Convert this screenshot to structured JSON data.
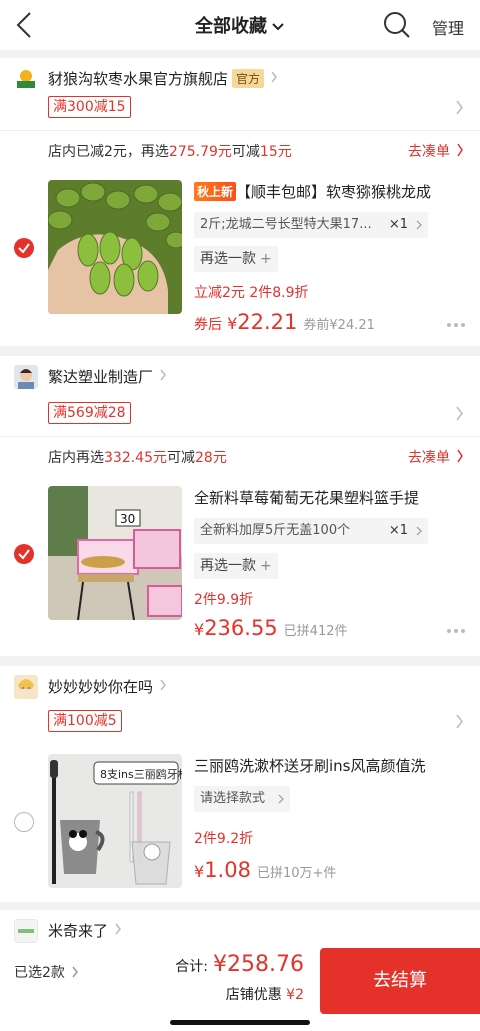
{
  "header": {
    "title": "全部收藏",
    "manage_label": "管理"
  },
  "stores": [
    {
      "name": "豺狼沟软枣水果官方旗舰店",
      "official_tag": "官方",
      "promo": "满300减15",
      "coudan_prefix": "店内已减2元，再选",
      "coudan_amount": "275.79元",
      "coudan_mid": "可减",
      "coudan_save": "15元",
      "coudan_link": "去凑单",
      "checked": true,
      "product": {
        "badge": "秋上新",
        "title": "【顺丰包邮】软枣猕猴桃龙成",
        "sku": "2斤;龙城二号长型特大果17...",
        "qty": "×1",
        "reselect": "再选一款",
        "discount": "立减2元 2件8.9折",
        "price_prefix": "券后",
        "price_symbol": "¥",
        "price": "22.21",
        "price_note": "券前¥24.21"
      }
    },
    {
      "name": "繁达塑业制造厂",
      "promo": "满569减28",
      "coudan_prefix": "店内再选",
      "coudan_amount": "332.45元",
      "coudan_mid": "可减",
      "coudan_save": "28元",
      "coudan_link": "去凑单",
      "checked": true,
      "product": {
        "title": "全新料草莓葡萄无花果塑料篮手提",
        "sku": "全新料加厚5斤无盖100个",
        "qty": "×1",
        "reselect": "再选一款",
        "discount": "2件9.9折",
        "price_symbol": "¥",
        "price": "236.55",
        "price_note": "已拼412件"
      }
    },
    {
      "name": "妙妙妙妙你在吗",
      "promo": "满100减5",
      "checked": false,
      "product": {
        "title": "三丽鸥洗漱杯送牙刷ins风高颜值洗",
        "sku": "请选择款式",
        "discount": "2件9.2折",
        "price_symbol": "¥",
        "price": "1.08",
        "price_note": "已拼10万+件",
        "image_text": "8支ins三丽鸥牙杯"
      }
    },
    {
      "name": "米奇来了"
    }
  ],
  "bottom": {
    "selected": "已选2款",
    "total_label": "合计:",
    "total_symbol": "¥",
    "total": "258.76",
    "shop_discount_label": "店铺优惠",
    "shop_discount": "¥2",
    "checkout_label": "去结算"
  },
  "colors": {
    "accent": "#e4322b",
    "background": "#f2f2f2"
  }
}
